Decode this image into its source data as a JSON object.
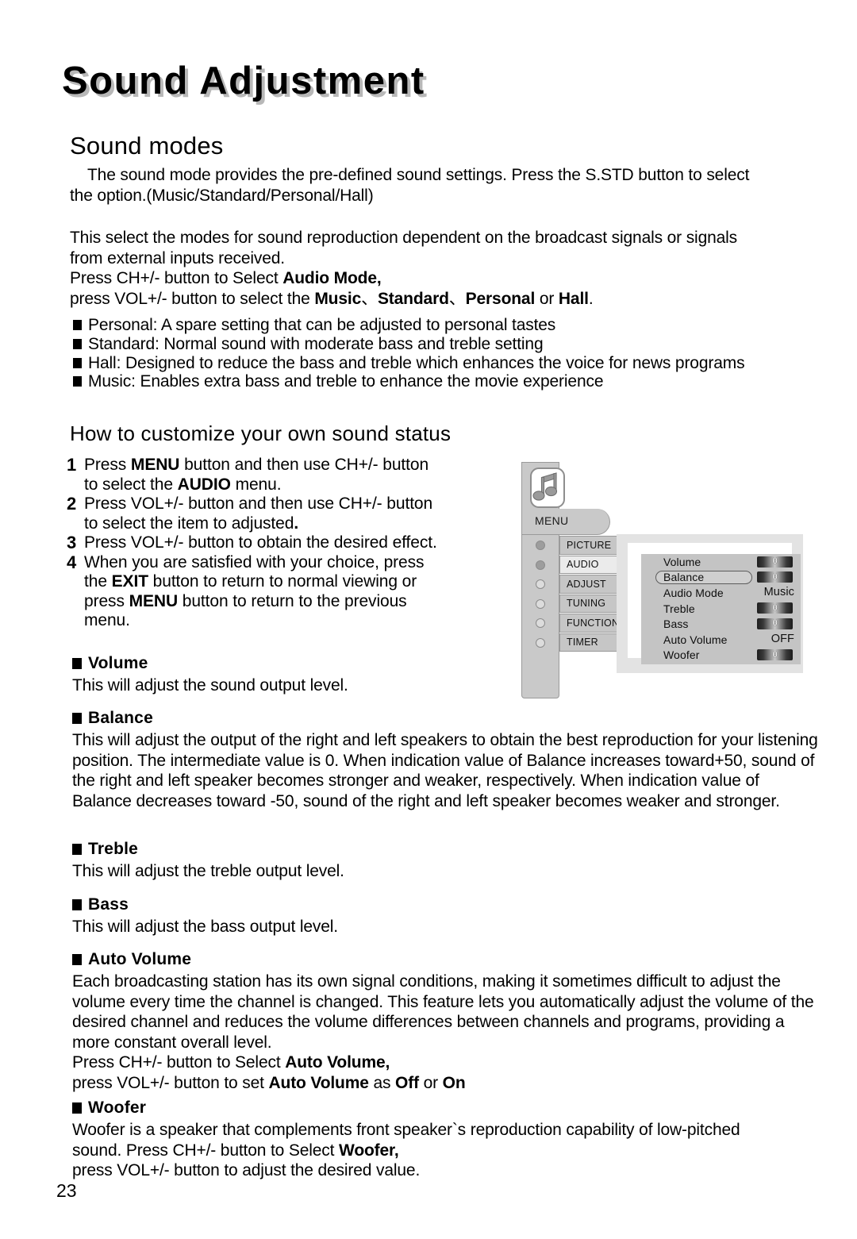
{
  "document": {
    "title": "Sound Adjustment",
    "page_number": "23"
  },
  "sound_modes": {
    "heading": "Sound modes",
    "intro_line_1": "The sound mode provides the pre-defined sound settings. Press the S.STD button to select",
    "intro_line_2": "the option.(Music/Standard/Personal/Hall)",
    "select_line_1": "This select the modes for sound reproduction dependent on the broadcast signals or signals",
    "select_line_2": "from external inputs received.",
    "select_line_3_pre": "Press CH+/- button to Select ",
    "select_line_3_bold": "Audio Mode,",
    "select_line_4_pre": "press VOL+/- button to select the ",
    "select_line_4_music": "Music",
    "select_line_4_sep1": "、",
    "select_line_4_standard": "Standard",
    "select_line_4_sep2": "、",
    "select_line_4_personal": "Personal",
    "select_line_4_or": " or ",
    "select_line_4_hall": "Hall",
    "select_line_4_end": ".",
    "bullets": [
      "Personal: A spare setting that can be adjusted to personal tastes",
      "Standard: Normal sound with moderate bass and treble setting",
      "Hall: Designed to reduce the bass and treble which enhances the voice for news programs",
      "Music: Enables extra bass and treble to enhance the movie experience"
    ]
  },
  "customize": {
    "heading": "How to customize your own sound status",
    "steps": [
      {
        "number": "1",
        "line_1_pre": "Press ",
        "line_1_bold": "MENU",
        "line_1_post": " button and then use CH+/- button",
        "line_2_pre": "to select the ",
        "line_2_bold": "AUDIO",
        "line_2_post": " menu."
      },
      {
        "number": "2",
        "line_1_pre": "Press VOL+/- button and then use CH+/- button",
        "line_1_bold": "",
        "line_1_post": "",
        "line_2_pre": "to select the item to adjusted",
        "line_2_bold": ".",
        "line_2_post": ""
      },
      {
        "number": "3",
        "line_1_pre": "Press VOL+/- button to obtain the desired effect.",
        "line_1_bold": "",
        "line_1_post": "",
        "line_2_pre": "",
        "line_2_bold": "",
        "line_2_post": ""
      },
      {
        "number": "4",
        "line_1_pre": "When you are satisfied with your choice, press",
        "line_1_bold": "",
        "line_1_post": "",
        "line_2_pre": "the ",
        "line_2_bold": "EXIT",
        "line_2_post": " button to return to normal viewing or",
        "line_3_pre": "press ",
        "line_3_bold": "MENU",
        "line_3_post": " button to return to the previous",
        "line_4": "menu."
      }
    ]
  },
  "sections": {
    "volume": {
      "title": "Volume",
      "body": "This will adjust the sound output level."
    },
    "balance": {
      "title": "Balance",
      "body": "This will adjust the output of the right and left speakers to obtain the best reproduction for your listening position. The intermediate value is 0. When indication value of Balance increases toward+50, sound of the right and left speaker becomes stronger and weaker, respectively. When indication value of Balance decreases toward -50, sound of the right and left speaker becomes weaker and stronger."
    },
    "treble": {
      "title": "Treble",
      "body": "This will adjust the treble output level."
    },
    "bass": {
      "title": "Bass",
      "body": "This will adjust the bass output level."
    },
    "auto_volume": {
      "title": "Auto Volume",
      "body": "Each broadcasting station has its own signal conditions, making it sometimes difficult to adjust the volume every time the channel is changed. This feature lets you automatically adjust the volume of the desired channel and reduces the volume differences between channels and programs, providing a more constant overall level.",
      "press_line_pre": "Press CH+/- button to Select ",
      "press_line_bold": "Auto Volume,",
      "press_line2_pre": "press VOL+/- button to set ",
      "press_line2_bold1": "Auto Volume",
      "press_line2_mid": " as ",
      "press_line2_bold2": "Off",
      "press_line2_or": " or ",
      "press_line2_bold3": "On"
    },
    "woofer": {
      "title": "Woofer",
      "body_line_1": "Woofer is a speaker that complements front speaker`s reproduction capability of low-pitched",
      "body_line_2_pre": "sound. Press CH+/- button to Select ",
      "body_line_2_bold": "Woofer,",
      "body_line_3": "press VOL+/- button to adjust the desired value."
    }
  },
  "osd": {
    "icon_name": "music-note-icon",
    "menu_label": "MENU",
    "menu_items": [
      {
        "label": "PICTURE",
        "selected": false
      },
      {
        "label": "AUDIO",
        "selected": true
      },
      {
        "label": "ADJUST",
        "selected": false
      },
      {
        "label": "TUNING",
        "selected": false
      },
      {
        "label": "FUNCTION",
        "selected": false
      },
      {
        "label": "TIMER",
        "selected": false
      }
    ],
    "settings": [
      {
        "label": "Volume",
        "value": "0",
        "type": "bar",
        "highlighted": false
      },
      {
        "label": "Balance",
        "value": "0",
        "type": "bar",
        "highlighted": true
      },
      {
        "label": "Audio Mode",
        "value": "Music",
        "type": "text",
        "highlighted": false
      },
      {
        "label": "Treble",
        "value": "0",
        "type": "bar",
        "highlighted": false
      },
      {
        "label": "Bass",
        "value": "0",
        "type": "bar",
        "highlighted": false
      },
      {
        "label": "Auto Volume",
        "value": "OFF",
        "type": "text",
        "highlighted": false
      },
      {
        "label": "Woofer",
        "value": "0",
        "type": "bar",
        "highlighted": false
      }
    ]
  },
  "colors": {
    "osd_gray": "#c9c9c9",
    "osd_active": "#ebebeb",
    "osd_border": "#9a9a9a",
    "title_shadow": "#b8b8b8"
  }
}
